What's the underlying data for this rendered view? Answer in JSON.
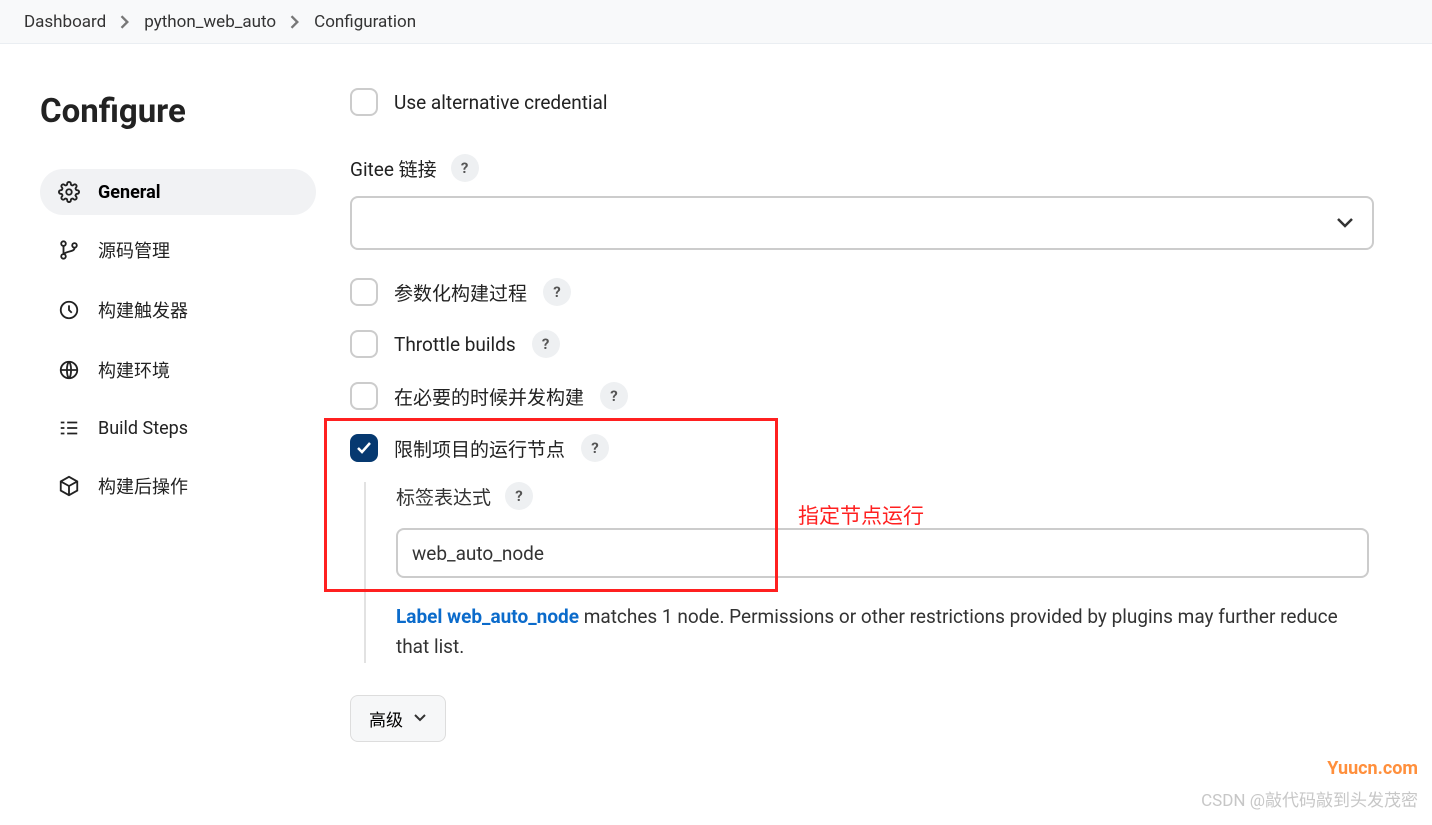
{
  "breadcrumb": {
    "items": [
      "Dashboard",
      "python_web_auto",
      "Configuration"
    ]
  },
  "sidebar": {
    "title": "Configure",
    "items": [
      {
        "label": "General"
      },
      {
        "label": "源码管理"
      },
      {
        "label": "构建触发器"
      },
      {
        "label": "构建环境"
      },
      {
        "label": "Build Steps"
      },
      {
        "label": "构建后操作"
      }
    ]
  },
  "form": {
    "alt_credential_label": "Use alternative credential",
    "gitee_label": "Gitee 链接",
    "gitee_value": "",
    "param_build_label": "参数化构建过程",
    "throttle_label": "Throttle builds",
    "concurrent_label": "在必要的时候并发构建",
    "restrict_label": "限制项目的运行节点",
    "label_expr_label": "标签表达式",
    "label_expr_value": "web_auto_node",
    "hint_prefix": "Label web_auto_node",
    "hint_rest": " matches 1 node. Permissions or other restrictions provided by plugins may further reduce that list.",
    "advanced_label": "高级"
  },
  "annotation": {
    "red_text": "指定节点运行"
  },
  "watermark": {
    "w1": "Yuucn.com",
    "w2": "CSDN @敲代码敲到头发茂密"
  }
}
